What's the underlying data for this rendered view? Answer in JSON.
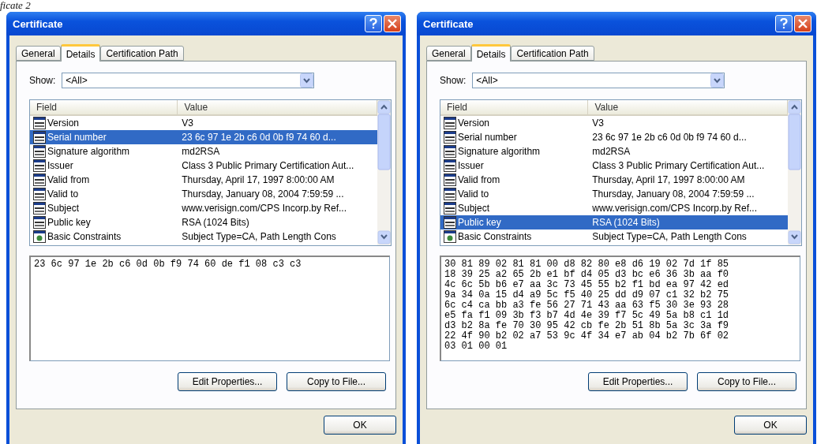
{
  "caption": "ficate 2",
  "dialogs": [
    {
      "title": "Certificate",
      "tabs": [
        {
          "label": "General",
          "selected": false
        },
        {
          "label": "Details",
          "selected": true
        },
        {
          "label": "Certification Path",
          "selected": false
        }
      ],
      "show": {
        "label": "Show:",
        "value": "<All>"
      },
      "columns": [
        "Field",
        "Value"
      ],
      "rows": [
        {
          "kind": "field",
          "field": "Version",
          "value": "V3",
          "selected": false
        },
        {
          "kind": "field",
          "field": "Serial number",
          "value": "23 6c 97 1e 2b c6 0d 0b f9 74 60 d...",
          "selected": true
        },
        {
          "kind": "field",
          "field": "Signature algorithm",
          "value": "md2RSA",
          "selected": false
        },
        {
          "kind": "field",
          "field": "Issuer",
          "value": "Class 3 Public Primary Certification Aut...",
          "selected": false
        },
        {
          "kind": "field",
          "field": "Valid from",
          "value": "Thursday, April 17, 1997 8:00:00 AM",
          "selected": false
        },
        {
          "kind": "field",
          "field": "Valid to",
          "value": "Thursday, January 08, 2004 7:59:59 ...",
          "selected": false
        },
        {
          "kind": "field",
          "field": "Subject",
          "value": "www.verisign.com/CPS Incorp.by Ref...",
          "selected": false
        },
        {
          "kind": "field",
          "field": "Public key",
          "value": "RSA (1024 Bits)",
          "selected": false
        },
        {
          "kind": "extension",
          "field": "Basic Constraints",
          "value": "Subject Type=CA, Path Length Cons",
          "selected": false
        }
      ],
      "detail": [
        "23 6c 97 1e 2b c6 0d 0b f9 74 60 de f1 08 c3 c3"
      ],
      "buttons": [
        "Edit Properties...",
        "Copy to File..."
      ],
      "ok": "OK"
    },
    {
      "title": "Certificate",
      "tabs": [
        {
          "label": "General",
          "selected": false
        },
        {
          "label": "Details",
          "selected": true
        },
        {
          "label": "Certification Path",
          "selected": false
        }
      ],
      "show": {
        "label": "Show:",
        "value": "<All>"
      },
      "columns": [
        "Field",
        "Value"
      ],
      "rows": [
        {
          "kind": "field",
          "field": "Version",
          "value": "V3",
          "selected": false
        },
        {
          "kind": "field",
          "field": "Serial number",
          "value": "23 6c 97 1e 2b c6 0d 0b f9 74 60 d...",
          "selected": false
        },
        {
          "kind": "field",
          "field": "Signature algorithm",
          "value": "md2RSA",
          "selected": false
        },
        {
          "kind": "field",
          "field": "Issuer",
          "value": "Class 3 Public Primary Certification Aut...",
          "selected": false
        },
        {
          "kind": "field",
          "field": "Valid from",
          "value": "Thursday, April 17, 1997 8:00:00 AM",
          "selected": false
        },
        {
          "kind": "field",
          "field": "Valid to",
          "value": "Thursday, January 08, 2004 7:59:59 ...",
          "selected": false
        },
        {
          "kind": "field",
          "field": "Subject",
          "value": "www.verisign.com/CPS Incorp.by Ref...",
          "selected": false
        },
        {
          "kind": "field",
          "field": "Public key",
          "value": "RSA (1024 Bits)",
          "selected": true
        },
        {
          "kind": "extension",
          "field": "Basic Constraints",
          "value": "Subject Type=CA, Path Length Cons",
          "selected": false
        }
      ],
      "detail": [
        "30 81 89 02 81 81 00 d8 82 80 e8 d6 19 02 7d 1f 85",
        "18 39 25 a2 65 2b e1 bf d4 05 d3 bc e6 36 3b aa f0",
        "4c 6c 5b b6 e7 aa 3c 73 45 55 b2 f1 bd ea 97 42 ed",
        "9a 34 0a 15 d4 a9 5c f5 40 25 dd d9 07 c1 32 b2 75",
        "6c c4 ca bb a3 fe 56 27 71 43 aa 63 f5 30 3e 93 28",
        "e5 fa f1 09 3b f3 b7 4d 4e 39 f7 5c 49 5a b8 c1 1d",
        "d3 b2 8a fe 70 30 95 42 cb fe 2b 51 8b 5a 3c 3a f9",
        "22 4f 90 b2 02 a7 53 9c 4f 34 e7 ab 04 b2 7b 6f 02",
        "03 01 00 01"
      ],
      "buttons": [
        "Edit Properties...",
        "Copy to File..."
      ],
      "ok": "OK"
    }
  ]
}
